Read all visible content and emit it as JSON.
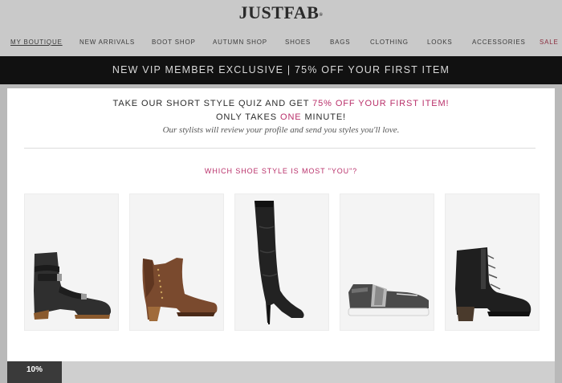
{
  "header": {
    "logo": "JUSTFAB",
    "logo_mark": "®",
    "nav": [
      {
        "label": "MY BOUTIQUE"
      },
      {
        "label": "NEW ARRIVALS"
      },
      {
        "label": "BOOT SHOP"
      },
      {
        "label": "AUTUMN SHOP"
      },
      {
        "label": "SHOES"
      },
      {
        "label": "BAGS"
      },
      {
        "label": "CLOTHING"
      },
      {
        "label": "LOOKS"
      },
      {
        "label": "ACCESSORIES"
      },
      {
        "label": "SALE"
      }
    ]
  },
  "promo": {
    "text": "NEW VIP MEMBER EXCLUSIVE | 75% OFF YOUR FIRST ITEM"
  },
  "quiz": {
    "line1_a": "TAKE OUR SHORT STYLE QUIZ AND GET ",
    "line1_highlight": "75% OFF YOUR FIRST ITEM!",
    "line2_a": "ONLY TAKES ",
    "line2_highlight": "ONE",
    "line2_b": " MINUTE!",
    "line3": "Our stylists will review your profile and send you styles you'll love.",
    "question": "WHICH SHOE STYLE IS MOST \"YOU\"?",
    "options": [
      {
        "style": "black-moto-boot-icon"
      },
      {
        "style": "brown-ankle-bootie-icon"
      },
      {
        "style": "black-over-the-knee-boot-icon"
      },
      {
        "style": "gray-sneaker-icon"
      },
      {
        "style": "black-lace-up-bootie-icon"
      }
    ]
  },
  "progress": {
    "label": "10%",
    "value": 0.1
  },
  "colors": {
    "accent": "#b9306a",
    "promo_bar": "#111111",
    "progress": "#3a3a3a"
  }
}
